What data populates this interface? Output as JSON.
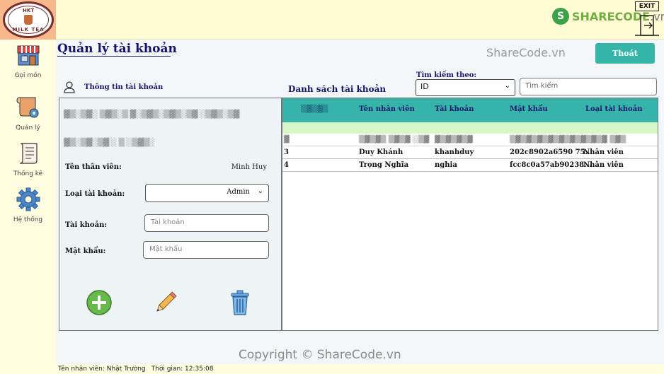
{
  "logo": {
    "top_text": "HKT",
    "bottom_text": "MILK TEA"
  },
  "watermark": {
    "brand": "SHARECODE",
    "brand_suffix": ".vn",
    "top_text": "ShareCode.vn",
    "copyright": "Copyright © ShareCode.vn"
  },
  "exit_icon": {
    "label": "EXIT"
  },
  "sidebar": {
    "items": [
      {
        "label": "Gọi món",
        "icon": "shop-icon"
      },
      {
        "label": "Quản lý",
        "icon": "manage-icon"
      },
      {
        "label": "Thống kê",
        "icon": "report-icon"
      },
      {
        "label": "Hệ thống",
        "icon": "gear-icon"
      }
    ]
  },
  "page": {
    "title": "Quản lý tài khoản",
    "exit_button": "Thoát"
  },
  "form": {
    "header": "Thông tin tài khoản",
    "fields": {
      "employee_name_label": "Tên thân viên:",
      "employee_name_value": "Minh Huy",
      "account_type_label": "Loại tài khoản:",
      "account_type_value": "Admin",
      "username_label": "Tài khoản:",
      "username_placeholder": "Tài khoản",
      "password_label": "Mật khẩu:",
      "password_placeholder": "Mật khẩu"
    }
  },
  "list": {
    "title": "Danh sách tài khoản",
    "search_label": "Tìm kiếm theo:",
    "search_by": "ID",
    "search_placeholder": "Tìm kiếm",
    "columns": [
      "Tên nhân viên",
      "Tài khoản",
      "Mật khẩu",
      "Loại tài khoản"
    ],
    "rows": [
      {
        "id": "3",
        "name": "Duy Khánh",
        "username": "khanhduy",
        "password": "202c8902a6590 75...",
        "type": "Nhân viên"
      },
      {
        "id": "4",
        "name": "Trọng Nghĩa",
        "username": "nghia",
        "password": "fcc8c0a57ab90238...",
        "type": "Nhân viên"
      }
    ]
  },
  "status": {
    "employee": "Tên nhân viên: Nhật Trường",
    "time": "Thời gian: 12:35:08"
  },
  "colors": {
    "accent": "#36b4aa",
    "title": "#14146e",
    "selected_row": "#d9f6c9"
  }
}
